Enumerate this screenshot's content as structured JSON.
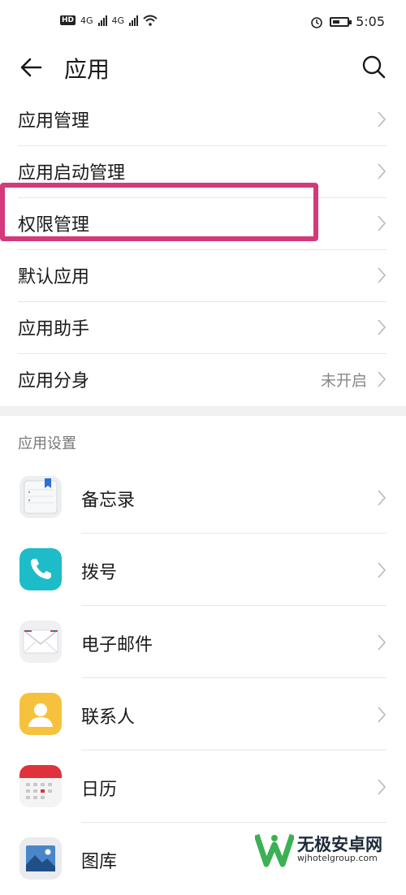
{
  "status_bar": {
    "hd_label": "HD",
    "net_a": "4G",
    "net_b": "4G",
    "time": "5:05",
    "icons": [
      "hd-icon",
      "signal-icon",
      "signal-icon",
      "wifi-icon",
      "alarm-icon",
      "battery-icon"
    ]
  },
  "header": {
    "title": "应用",
    "back_icon": "back-arrow-icon",
    "search_icon": "search-icon"
  },
  "menu": [
    {
      "label": "应用管理"
    },
    {
      "label": "应用启动管理"
    },
    {
      "label": "权限管理",
      "highlighted": true
    },
    {
      "label": "默认应用"
    },
    {
      "label": "应用助手"
    },
    {
      "label": "应用分身",
      "value": "未开启"
    }
  ],
  "section": {
    "title": "应用设置"
  },
  "apps": [
    {
      "label": "备忘录",
      "icon": "notepad-icon"
    },
    {
      "label": "拨号",
      "icon": "phone-icon"
    },
    {
      "label": "电子邮件",
      "icon": "mail-icon"
    },
    {
      "label": "联系人",
      "icon": "contacts-icon"
    },
    {
      "label": "日历",
      "icon": "calendar-icon"
    },
    {
      "label": "图库",
      "icon": "gallery-icon"
    }
  ],
  "watermark": {
    "text": "无极安卓网",
    "url": "wjhotelgroup.com"
  },
  "colors": {
    "highlight": "#d43a7a",
    "phone": "#1ebcc8",
    "contacts": "#f6c23e",
    "calendar": "#e0323c"
  }
}
